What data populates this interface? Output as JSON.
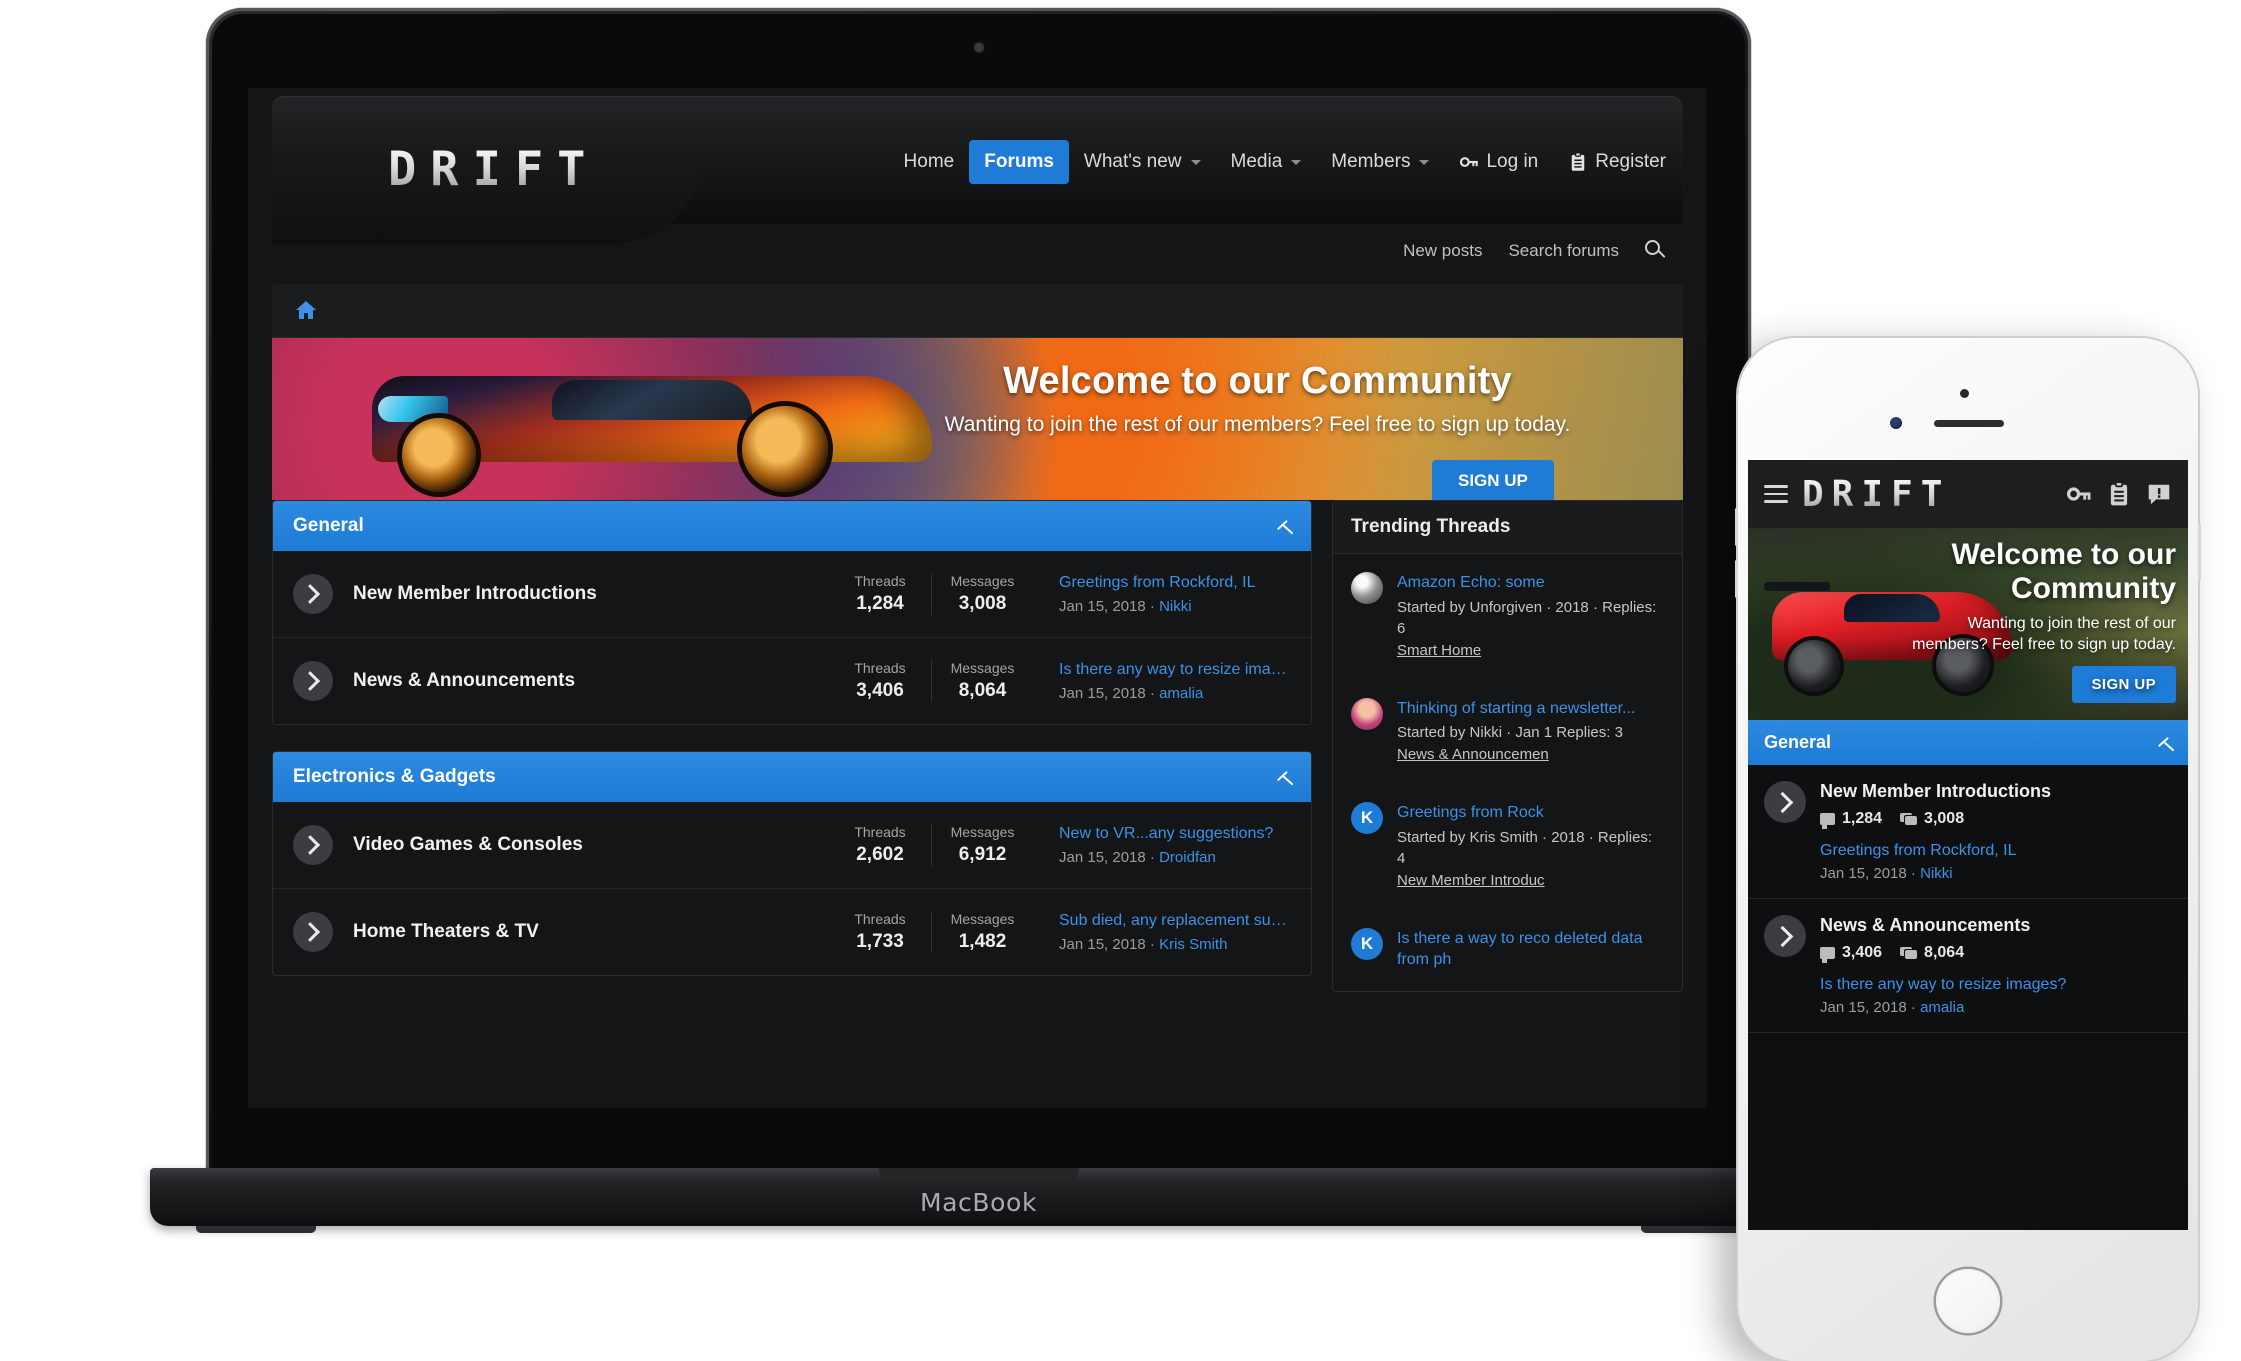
{
  "device": {
    "laptop_label": "MacBook"
  },
  "site": {
    "logo": "DRIFT"
  },
  "colors": {
    "accent": "#1e7bd6",
    "link": "#3d92e8",
    "page_bg": "#141517",
    "panel_bg": "#141516"
  },
  "desktop": {
    "nav": [
      {
        "label": "Home",
        "icon": "",
        "caret": false,
        "active": false
      },
      {
        "label": "Forums",
        "icon": "",
        "caret": false,
        "active": true
      },
      {
        "label": "What's new",
        "icon": "",
        "caret": true,
        "active": false
      },
      {
        "label": "Media",
        "icon": "",
        "caret": true,
        "active": false
      },
      {
        "label": "Members",
        "icon": "",
        "caret": true,
        "active": false
      },
      {
        "label": "Log in",
        "icon": "key-icon",
        "caret": false,
        "active": false
      },
      {
        "label": "Register",
        "icon": "clipboard-icon",
        "caret": false,
        "active": false
      }
    ],
    "subnav": {
      "new_posts": "New posts",
      "search_forums": "Search forums",
      "search_icon": "search-icon"
    },
    "breadcrumb": {
      "home_icon": "home-icon"
    },
    "hero": {
      "title": "Welcome to our Community",
      "subtitle": "Wanting to join the rest of our members? Feel free to sign up today.",
      "button": "SIGN UP"
    },
    "categories": [
      {
        "title": "General",
        "collapse_icon": "chevron-up-icon",
        "forums": [
          {
            "name": "New Member Introductions",
            "threads_label": "Threads",
            "threads": "1,284",
            "messages_label": "Messages",
            "messages": "3,008",
            "last_title": "Greetings from Rockford, IL",
            "last_date": "Jan 15, 2018",
            "last_user": "Nikki"
          },
          {
            "name": "News & Announcements",
            "threads_label": "Threads",
            "threads": "3,406",
            "messages_label": "Messages",
            "messages": "8,064",
            "last_title": "Is there any way to resize image…",
            "last_date": "Jan 15, 2018",
            "last_user": "amalia"
          }
        ]
      },
      {
        "title": "Electronics & Gadgets",
        "collapse_icon": "chevron-up-icon",
        "forums": [
          {
            "name": "Video Games & Consoles",
            "threads_label": "Threads",
            "threads": "2,602",
            "messages_label": "Messages",
            "messages": "6,912",
            "last_title": "New to VR...any suggestions?",
            "last_date": "Jan 15, 2018",
            "last_user": "Droidfan"
          },
          {
            "name": "Home Theaters & TV",
            "threads_label": "Threads",
            "threads": "1,733",
            "messages_label": "Messages",
            "messages": "1,482",
            "last_title": "Sub died, any replacement sugg…",
            "last_date": "Jan 15, 2018",
            "last_user": "Kris Smith"
          }
        ]
      }
    ],
    "sidebar": {
      "title": "Trending Threads",
      "threads": [
        {
          "title": "Amazon Echo: some",
          "meta": "Started by Unforgiven · 2018 · Replies: 6",
          "node": "Smart Home",
          "avatar": "mountain-avatar",
          "avatar_letter": ""
        },
        {
          "title": "Thinking of starting a newsletter...",
          "meta": "Started by Nikki · Jan 1 Replies: 3",
          "node": "News & Announcemen",
          "avatar": "girl-avatar",
          "avatar_letter": ""
        },
        {
          "title": "Greetings from Rock",
          "meta": "Started by Kris Smith · 2018 · Replies: 4",
          "node": "New Member Introduc",
          "avatar": "letter-avatar",
          "avatar_letter": "K"
        },
        {
          "title": "Is there a way to reco deleted data from ph",
          "meta": "",
          "node": "",
          "avatar": "letter-avatar",
          "avatar_letter": "K"
        }
      ]
    }
  },
  "mobile": {
    "header": {
      "menu_icon": "hamburger-menu-icon",
      "logo": "DRIFT",
      "login_icon": "key-icon",
      "register_icon": "clipboard-icon",
      "alerts_icon": "alert-bubble-icon"
    },
    "hero": {
      "title": "Welcome to our Community",
      "subtitle": "Wanting to join the rest of our members? Feel free to sign up today.",
      "button": "SIGN UP"
    },
    "category": {
      "title": "General",
      "collapse_icon": "chevron-up-icon"
    },
    "forums": [
      {
        "name": "New Member Introductions",
        "threads": "1,284",
        "messages": "3,008",
        "last_title": "Greetings from Rockford, IL",
        "last_date": "Jan 15, 2018",
        "last_user": "Nikki"
      },
      {
        "name": "News & Announcements",
        "threads": "3,406",
        "messages": "8,064",
        "last_title": "Is there any way to resize images?",
        "last_date": "Jan 15, 2018",
        "last_user": "amalia"
      }
    ]
  }
}
